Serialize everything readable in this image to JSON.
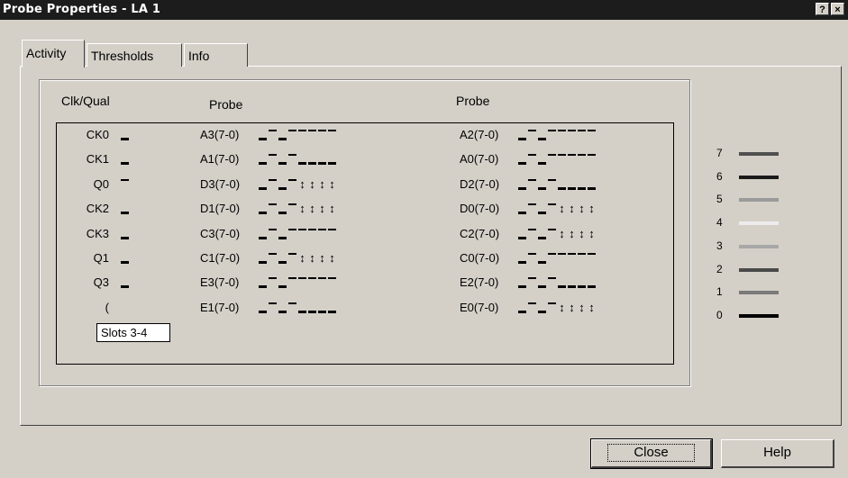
{
  "window": {
    "title": "Probe Properties - LA 1",
    "help_btn": "?",
    "close_btn": "×"
  },
  "tabs": [
    {
      "label": "Activity",
      "active": true
    },
    {
      "label": "Thresholds",
      "active": false
    },
    {
      "label": "Info",
      "active": false
    }
  ],
  "headers": {
    "clk": "Clk/Qual",
    "probe1": "Probe",
    "probe2": "Probe"
  },
  "rows": [
    {
      "clk": "CK0",
      "clk_sig": "L",
      "p1": "A3(7-0)",
      "p1_sig": "LHLHHHHH",
      "p2": "A2(7-0)",
      "p2_sig": "LHLHHHHH"
    },
    {
      "clk": "CK1",
      "clk_sig": "L",
      "p1": "A1(7-0)",
      "p1_sig": "LHLHLLLL",
      "p2": "A0(7-0)",
      "p2_sig": "LHLHHHHH"
    },
    {
      "clk": "Q0",
      "clk_sig": "H",
      "p1": "D3(7-0)",
      "p1_sig": "LHLHTTTT",
      "p2": "D2(7-0)",
      "p2_sig": "LHLHLLLL"
    },
    {
      "clk": "CK2",
      "clk_sig": "L",
      "p1": "D1(7-0)",
      "p1_sig": "LHLHTTTT",
      "p2": "D0(7-0)",
      "p2_sig": "LHLHTTTT"
    },
    {
      "clk": "CK3",
      "clk_sig": "L",
      "p1": "C3(7-0)",
      "p1_sig": "LHLHHHHH",
      "p2": "C2(7-0)",
      "p2_sig": "LHLHTTTT"
    },
    {
      "clk": "Q1",
      "clk_sig": "L",
      "p1": "C1(7-0)",
      "p1_sig": "LHLHTTTT",
      "p2": "C0(7-0)",
      "p2_sig": "LHLHHHHH"
    },
    {
      "clk": "Q3",
      "clk_sig": "L",
      "p1": "E3(7-0)",
      "p1_sig": "LHLHHHHH",
      "p2": "E2(7-0)",
      "p2_sig": "LHLHLLLL"
    },
    {
      "clk": "(",
      "clk_sig": "",
      "p1": "E1(7-0)",
      "p1_sig": "LHLHLLLL",
      "p2": "E0(7-0)",
      "p2_sig": "LHLHTTTT"
    }
  ],
  "tooltip": "Slots 3-4",
  "legend": [
    {
      "label": "7",
      "color": "#505050"
    },
    {
      "label": "6",
      "color": "#1a1a1a"
    },
    {
      "label": "5",
      "color": "#9a9a9a"
    },
    {
      "label": "4",
      "color": "#ececec"
    },
    {
      "label": "3",
      "color": "#a8a8a8"
    },
    {
      "label": "2",
      "color": "#4a4a4a"
    },
    {
      "label": "1",
      "color": "#7a7a7a"
    },
    {
      "label": "0",
      "color": "#000000"
    }
  ],
  "buttons": {
    "close": "Close",
    "help": "Help"
  }
}
